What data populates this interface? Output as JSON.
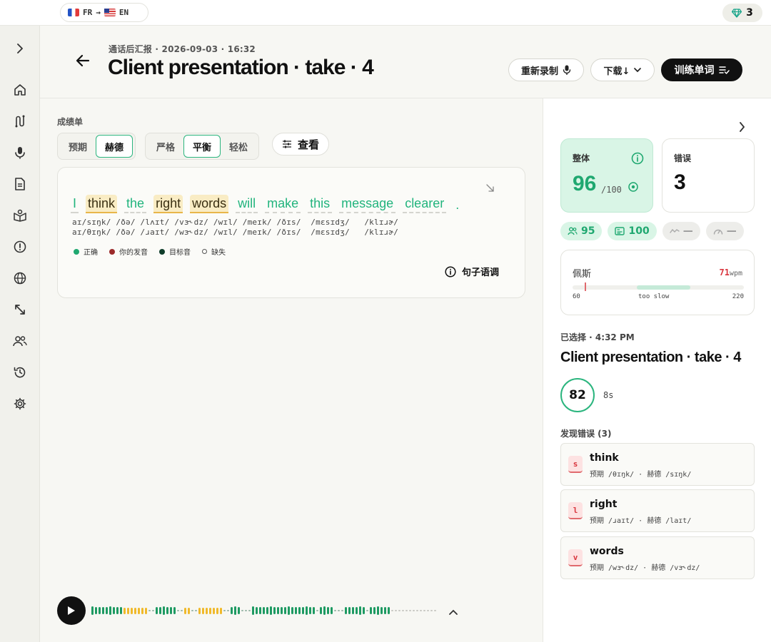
{
  "topbar": {
    "lang_from": "FR",
    "lang_to": "EN",
    "gems": "3"
  },
  "sidebar": {
    "toggle_icon": "chevron-right-icon",
    "items": [
      {
        "icon": "home-icon"
      },
      {
        "icon": "route-icon"
      },
      {
        "icon": "mic-icon"
      },
      {
        "icon": "document-icon"
      },
      {
        "icon": "book-icon"
      },
      {
        "icon": "alert-icon"
      },
      {
        "icon": "globe-icon"
      },
      {
        "icon": "expand-icon"
      },
      {
        "icon": "people-icon"
      },
      {
        "icon": "history-icon"
      },
      {
        "icon": "gear-icon"
      }
    ]
  },
  "header": {
    "subtitle": "通话后汇报 · 2026-09-03 · 16:32",
    "title": "Client presentation · take · 4",
    "rerecord_label": "重新录制",
    "download_label": "下载↓",
    "train_label": "训练单词"
  },
  "scorecard": {
    "section_label": "成绩单",
    "mode_tabs": [
      "预期",
      "赫德"
    ],
    "mode_active": 1,
    "strictness_tabs": [
      "严格",
      "平衡",
      "轻松"
    ],
    "strictness_active": 1,
    "view_label": "查看"
  },
  "sentence": {
    "words": [
      {
        "text": "I",
        "status": "correct"
      },
      {
        "text": "think",
        "status": "error"
      },
      {
        "text": "the",
        "status": "correct"
      },
      {
        "text": "right",
        "status": "error"
      },
      {
        "text": "words",
        "status": "error"
      },
      {
        "text": "will",
        "status": "correct"
      },
      {
        "text": "make",
        "status": "correct"
      },
      {
        "text": "this",
        "status": "correct"
      },
      {
        "text": "message",
        "status": "correct"
      },
      {
        "text": "clearer",
        "status": "correct"
      },
      {
        "text": ".",
        "status": "punct"
      }
    ],
    "ipa_heard": "aɪ/sɪŋk/ /ðə/ /lʌɪt/ /vɜ˞dz/ /wɪl/ /meɪk/ /ðɪs/  /mɛsɪdʒ/   /klɪɹɚ/",
    "ipa_target": "aɪ/θɪŋk/ /ðə/ /ɹaɪt/ /wɜ˞dz/ /wɪl/ /meɪk/ /ðɪs/  /mɛsɪdʒ/   /klɪɹɚ/",
    "legend": [
      {
        "label": "正确",
        "color": "#1fa870"
      },
      {
        "label": "你的发音",
        "color": "#9b2a2a"
      },
      {
        "label": "目标音",
        "color": "#0f3d2a"
      },
      {
        "label": "缺失",
        "color": "hollow"
      }
    ],
    "intonation_label": "句子语调"
  },
  "player": {
    "play_icon": "play-icon"
  },
  "right": {
    "overall_label": "整体",
    "overall_score": "96",
    "overall_of": "/100",
    "errors_label": "错误",
    "errors_count": "3",
    "chips": [
      {
        "icon": "people-icon",
        "value": "95",
        "style": "green"
      },
      {
        "icon": "card-icon",
        "value": "100",
        "style": "green"
      },
      {
        "icon": "wave-icon",
        "value": "—",
        "style": "gray"
      },
      {
        "icon": "gauge-icon",
        "value": "—",
        "style": "gray"
      }
    ],
    "pace_label": "佩斯",
    "pace_value": "71",
    "pace_unit": "wpm",
    "pace_min": "60",
    "pace_note": "too slow",
    "pace_max": "220",
    "pace_level": 71,
    "pace_band": [
      120,
      170
    ],
    "selected_label": "已选择 · 4:32 PM",
    "selected_title": "Client presentation · take · 4",
    "selected_score": "82",
    "selected_duration": "8s",
    "found_label": "发现错误 (3)",
    "errors": [
      {
        "badge": "s",
        "word": "think",
        "detail": "预期 /θɪŋk/ · 赫德 /sɪŋk/"
      },
      {
        "badge": "l",
        "word": "right",
        "detail": "预期 /ɹaɪt/ · 赫德 /laɪt/"
      },
      {
        "badge": "v",
        "word": "words",
        "detail": "预期 /wɜ˞dz/ · 赫德 /vɜ˞dz/"
      }
    ]
  }
}
